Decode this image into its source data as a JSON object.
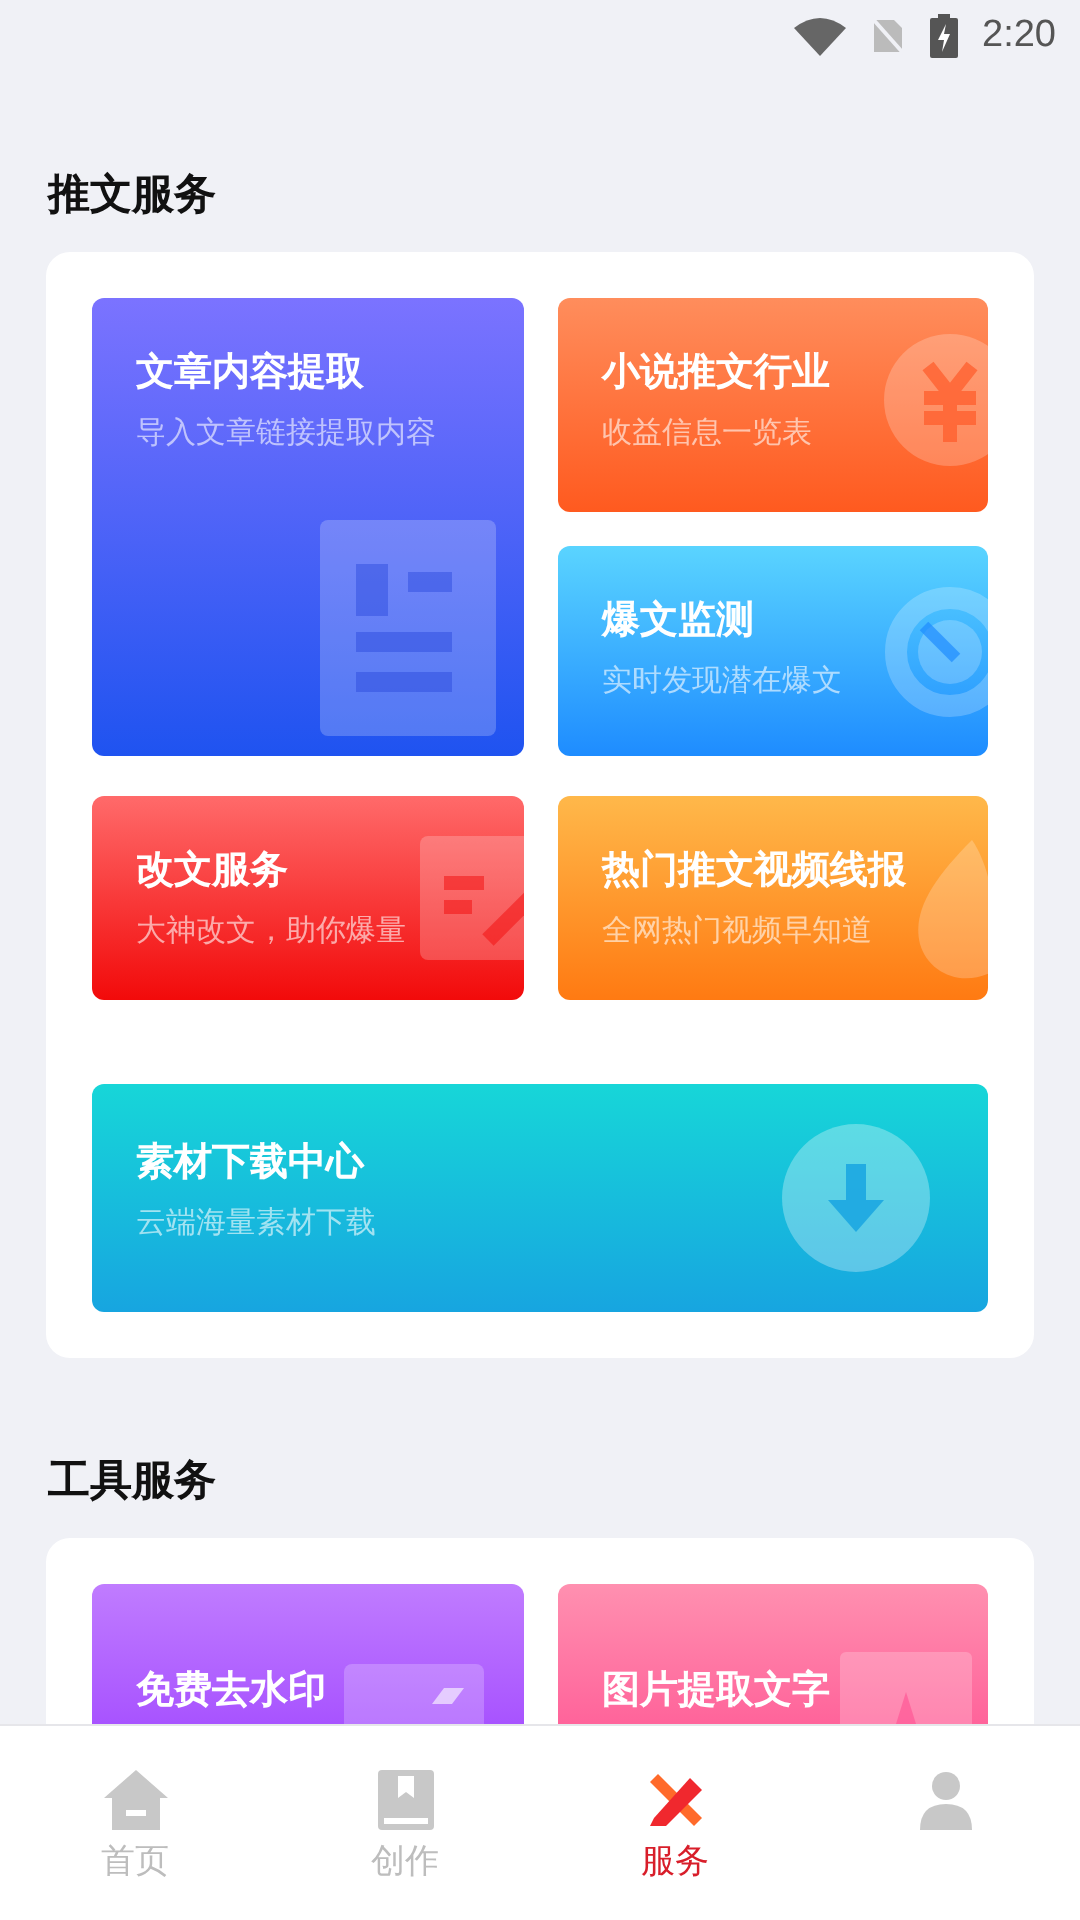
{
  "status_bar": {
    "time": "2:20"
  },
  "sections": [
    {
      "title": "推文服务",
      "tiles": [
        {
          "kind": "doc",
          "title": "文章内容提取",
          "subtitle": "导入文章链接提取内容"
        },
        {
          "kind": "yen",
          "title": "小说推文行业",
          "subtitle": "收益信息一览表"
        },
        {
          "kind": "target",
          "title": "爆文监测",
          "subtitle": "实时发现潜在爆文"
        },
        {
          "kind": "edit",
          "title": "改文服务",
          "subtitle": "大神改文，助你爆量"
        },
        {
          "kind": "flame",
          "title": "热门推文视频线报",
          "subtitle": "全网热门视频早知道"
        },
        {
          "kind": "download",
          "title": "素材下载中心",
          "subtitle": "云端海量素材下载"
        }
      ]
    },
    {
      "title": "工具服务",
      "tiles": [
        {
          "kind": "video",
          "title": "免费去水印"
        },
        {
          "kind": "letter",
          "title": "图片提取文字"
        }
      ]
    }
  ],
  "tab_bar": [
    {
      "kind": "home",
      "label": "首页",
      "selected": false
    },
    {
      "kind": "book",
      "label": "创作",
      "selected": false
    },
    {
      "kind": "tools",
      "label": "服务",
      "selected": true
    },
    {
      "kind": "person",
      "selected": false
    }
  ]
}
